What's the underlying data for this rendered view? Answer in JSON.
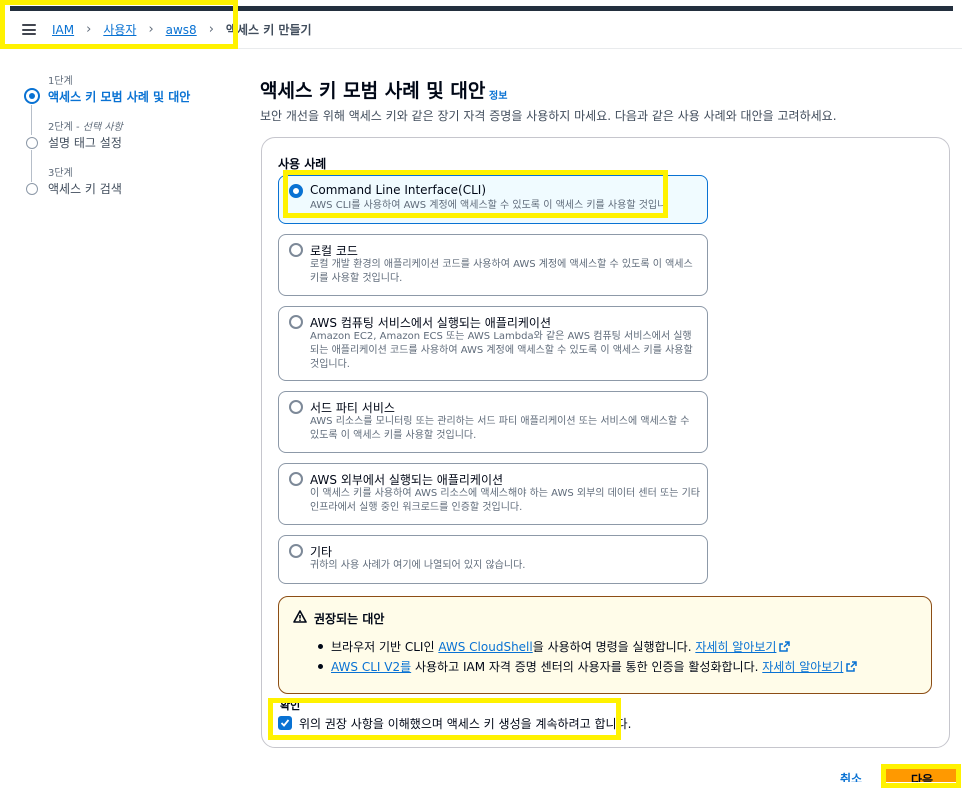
{
  "breadcrumb": {
    "items": [
      "IAM",
      "사용자",
      "aws8"
    ],
    "current": "액세스 키 만들기"
  },
  "steps": [
    {
      "sub": "1단계",
      "title": "액세스 키 모범 사례 및 대안",
      "active": true
    },
    {
      "sub": "2단계 -",
      "sub_italic": "선택 사항",
      "title": "설명 태그 설정",
      "active": false
    },
    {
      "sub": "3단계",
      "title": "액세스 키 검색",
      "active": false
    }
  ],
  "header": {
    "title": "액세스 키 모범 사례 및 대안",
    "info": "정보",
    "description": "보안 개선을 위해 액세스 키와 같은 장기 자격 증명을 사용하지 마세요. 다음과 같은 사용 사례와 대안을 고려하세요."
  },
  "use_case": {
    "label": "사용 사례",
    "options": [
      {
        "title": "Command Line Interface(CLI)",
        "desc": "AWS CLI를 사용하여 AWS 계정에 액세스할 수 있도록 이 액세스 키를 사용할 것입니다.",
        "selected": true
      },
      {
        "title": "로컬 코드",
        "desc": "로컬 개발 환경의 애플리케이션 코드를 사용하여 AWS 계정에 액세스할 수 있도록 이 액세스 키를 사용할 것입니다.",
        "selected": false
      },
      {
        "title": "AWS 컴퓨팅 서비스에서 실행되는 애플리케이션",
        "desc": "Amazon EC2, Amazon ECS 또는 AWS Lambda와 같은 AWS 컴퓨팅 서비스에서 실행되는 애플리케이션 코드를 사용하여 AWS 계정에 액세스할 수 있도록 이 액세스 키를 사용할 것입니다.",
        "selected": false
      },
      {
        "title": "서드 파티 서비스",
        "desc": "AWS 리소스를 모니터링 또는 관리하는 서드 파티 애플리케이션 또는 서비스에 액세스할 수 있도록 이 액세스 키를 사용할 것입니다.",
        "selected": false
      },
      {
        "title": "AWS 외부에서 실행되는 애플리케이션",
        "desc": "이 액세스 키를 사용하여 AWS 리소스에 액세스해야 하는 AWS 외부의 데이터 센터 또는 기타 인프라에서 실행 중인 워크로드를 인증할 것입니다.",
        "selected": false
      },
      {
        "title": "기타",
        "desc": "귀하의 사용 사례가 여기에 나열되어 있지 않습니다.",
        "selected": false
      }
    ]
  },
  "alert": {
    "title": "권장되는 대안",
    "item1_pre": "브라우저 기반 CLI인 ",
    "item1_link": "AWS CloudShell",
    "item1_post": "을 사용하여 명령을 실행합니다. ",
    "item1_more": "자세히 알아보기",
    "item2_link": "AWS CLI V2를",
    "item2_post": " 사용하고 IAM 자격 증명 센터의 사용자를 통한 인증을 활성화합니다. ",
    "item2_more": "자세히 알아보기"
  },
  "confirm": {
    "label": "확인",
    "text": "위의 권장 사항을 이해했으며 액세스 키 생성을 계속하려고 합니다.",
    "checked": true
  },
  "footer": {
    "cancel": "취소",
    "next": "다음"
  },
  "colors": {
    "accent": "#0972d3",
    "primary_button": "#ff9900",
    "highlight": "#fff200",
    "alert_bg": "#fffce9"
  }
}
